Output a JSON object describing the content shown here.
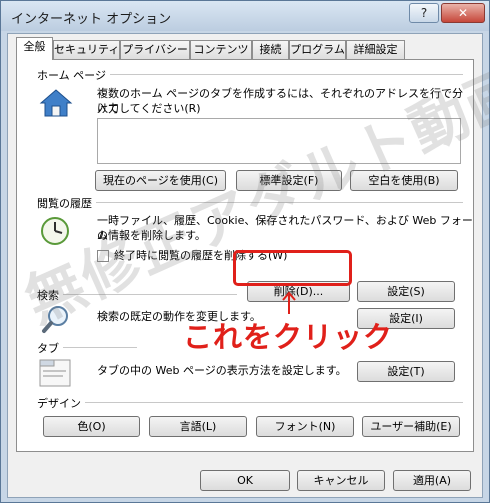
{
  "window": {
    "title": "インターネット オプション",
    "help_label": "?",
    "close_label": "✕"
  },
  "tabs": [
    {
      "label": "全般",
      "active": true
    },
    {
      "label": "セキュリティ",
      "active": false
    },
    {
      "label": "プライバシー",
      "active": false
    },
    {
      "label": "コンテンツ",
      "active": false
    },
    {
      "label": "接続",
      "active": false
    },
    {
      "label": "プログラム",
      "active": false
    },
    {
      "label": "詳細設定",
      "active": false
    }
  ],
  "home": {
    "title": "ホーム ページ",
    "icon": "home-icon",
    "description_line1": "複数のホーム ページのタブを作成するには、それぞれのアドレスを行で分けて",
    "description_line2": "入力してください(R)",
    "address_value": "",
    "use_current_label": "現在のページを使用(C)",
    "use_default_label": "標準設定(F)",
    "use_blank_label": "空白を使用(B)"
  },
  "history": {
    "title": "閲覧の履歴",
    "icon": "history-clock-icon",
    "description_line1": "一時ファイル、履歴、Cookie、保存されたパスワード、および Web フォーム",
    "description_line2": "の情報を削除します。",
    "checkbox_label": "終了時に閲覧の履歴を削除する(W)",
    "checkbox_checked": false,
    "delete_label": "削除(D)...",
    "settings_label": "設定(S)"
  },
  "search": {
    "title": "検索",
    "icon": "search-magnifier-icon",
    "description": "検索の既定の動作を変更します。",
    "settings_label": "設定(I)"
  },
  "tabs_section": {
    "title": "タブ",
    "icon": "tabs-window-icon",
    "description": "タブの中の Web ページの表示方法を設定します。",
    "settings_label": "設定(T)"
  },
  "design": {
    "title": "デザイン",
    "colors_label": "色(O)",
    "languages_label": "言語(L)",
    "fonts_label": "フォント(N)",
    "accessibility_label": "ユーザー補助(E)"
  },
  "footer": {
    "ok_label": "OK",
    "cancel_label": "キャンセル",
    "apply_label": "適用(A)"
  },
  "annotation": {
    "text": "これをクリック",
    "color": "#e0201a"
  },
  "watermark": {
    "text": "無修正アダルト動画部"
  }
}
